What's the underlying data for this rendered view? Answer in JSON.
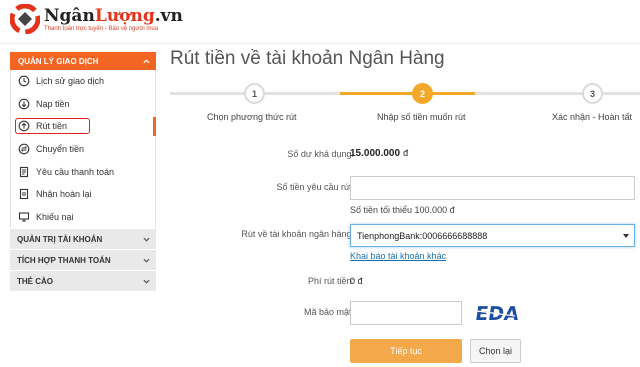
{
  "brand": {
    "name_part1": "Ngân",
    "name_part2": "Lượng",
    "name_part3": ".vn",
    "tagline": "Thanh toán trực tuyến - Bảo vệ người mua",
    "accent_color": "#f26522"
  },
  "sidebar": {
    "section_title": "QUẢN LÝ GIAO DỊCH",
    "items": [
      {
        "label": "Lịch sử giao dịch",
        "icon": "history-icon"
      },
      {
        "label": "Nạp tiền",
        "icon": "deposit-icon"
      },
      {
        "label": "Rút tiền",
        "icon": "withdraw-icon",
        "active": true
      },
      {
        "label": "Chuyển tiền",
        "icon": "transfer-icon"
      },
      {
        "label": "Yêu cầu thanh toán",
        "icon": "payment-request-icon"
      },
      {
        "label": "Nhận hoàn lại",
        "icon": "refund-icon"
      },
      {
        "label": "Khiếu nại",
        "icon": "complaint-icon"
      }
    ],
    "groups": [
      {
        "label": "QUẢN TRỊ TÀI KHOẢN"
      },
      {
        "label": "TÍCH HỢP THANH TOÁN"
      },
      {
        "label": "THẺ CÀO"
      }
    ]
  },
  "main": {
    "title": "Rút tiền về tài khoản Ngân Hàng",
    "steps": [
      {
        "number": "1",
        "label": "Chọn phương thức rút",
        "active": false
      },
      {
        "number": "2",
        "label": "Nhập số tiền muốn rút",
        "active": true
      },
      {
        "number": "3",
        "label": "Xác nhận - Hoàn tất",
        "active": false
      }
    ],
    "form": {
      "balance_label": "Số dư khả dụng:",
      "balance_value": "15.000.000",
      "balance_unit": "đ",
      "amount_label": "Số tiền yêu cầu rút:",
      "amount_value": "",
      "amount_hint": "Số tiền tối thiểu 100.000 đ",
      "bank_label": "Rút về tài khoản ngân hàng:",
      "bank_selected": "TienphongBank:0006666688888",
      "bank_link": "Khai báo tài khoản khác",
      "fee_label": "Phí rút tiền:",
      "fee_value": "0 đ",
      "captcha_label": "Mã bảo mật:",
      "captcha_text": "EDA",
      "submit_label": "Tiếp tục",
      "reset_label": "Chọn lại"
    }
  }
}
